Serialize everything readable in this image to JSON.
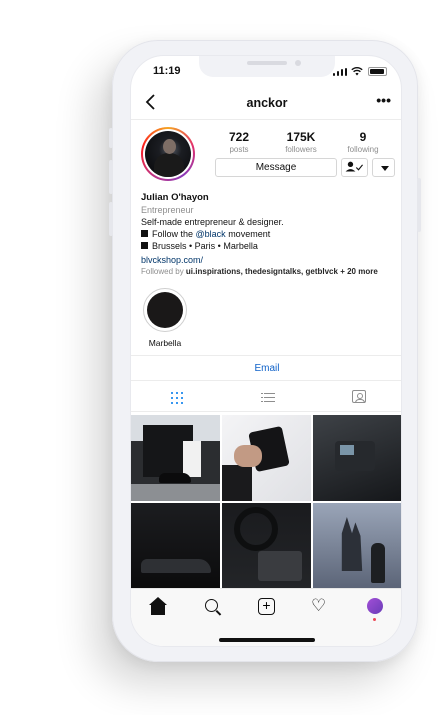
{
  "status": {
    "time": "11:19"
  },
  "header": {
    "username": "anckor"
  },
  "profile": {
    "stats": [
      {
        "value": "722",
        "label": "posts"
      },
      {
        "value": "175K",
        "label": "followers"
      },
      {
        "value": "9",
        "label": "following"
      }
    ],
    "message_label": "Message",
    "name": "Julian O'hayon",
    "category": "Entrepreneur",
    "bio_line1": "Self-made entrepreneur & designer.",
    "bio_line2_prefix": "Follow the ",
    "bio_line2_mention": "@black",
    "bio_line2_suffix": " movement",
    "bio_line3": "Brussels • Paris • Marbella",
    "website": "blvckshop.com/",
    "followed_by_prefix": "Followed by ",
    "followed_by_names": "ui.inspirations, thedesigntalks, getblvck",
    "followed_by_suffix": " + 20 more"
  },
  "highlights": [
    {
      "label": "Marbella"
    }
  ],
  "contact": {
    "email_label": "Email"
  },
  "colors": {
    "link": "#003569",
    "email": "#0f62c9",
    "active_tab": "#3897f0",
    "notification_dot": "#ed4956"
  }
}
